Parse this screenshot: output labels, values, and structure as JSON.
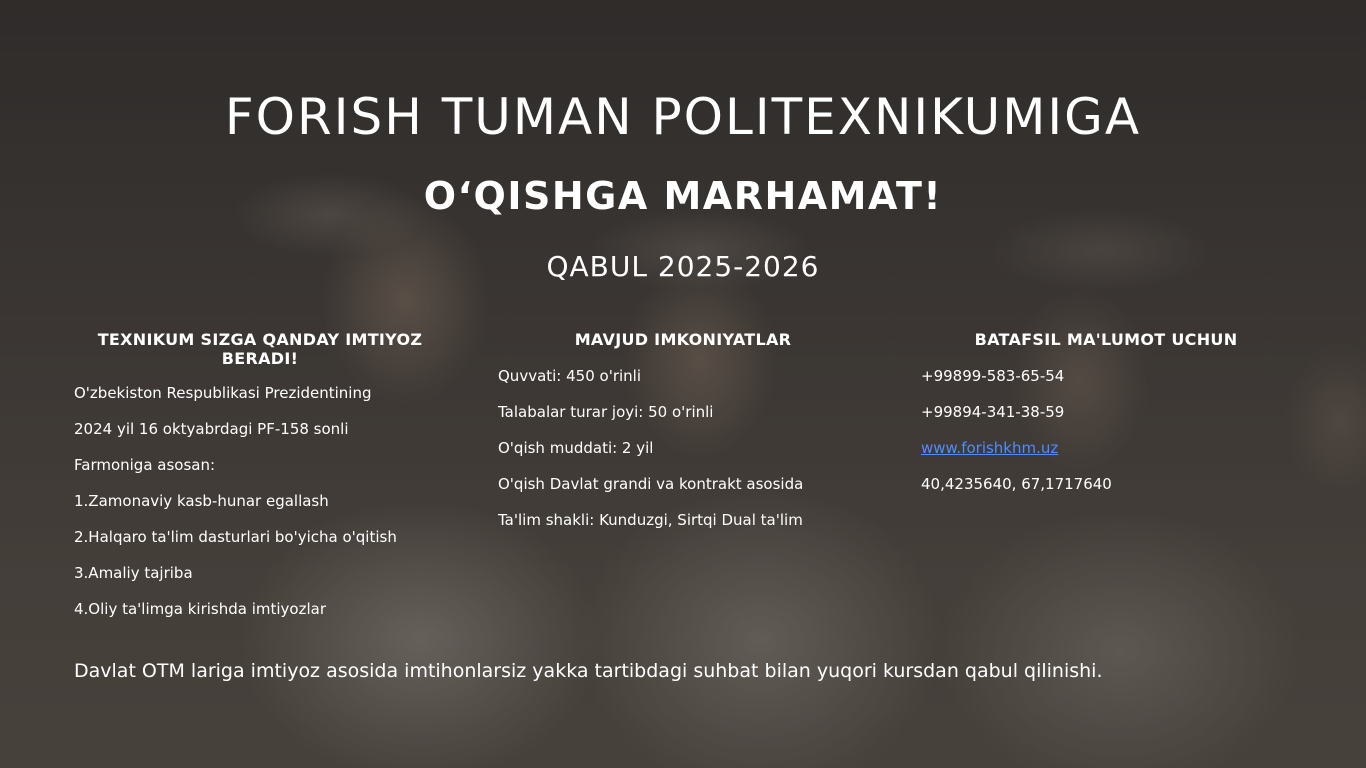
{
  "header": {
    "title": "FORISH TUMAN POLITEXNIKUMIGA",
    "subtitle": "O‘QISHGA MARHAMAT!",
    "admission": "QABUL 2025-2026"
  },
  "columns": {
    "benefits": {
      "heading": "TEXNIKUM SIZGA QANDAY IMTIYOZ BERADI!",
      "items": [
        "O'zbekiston Respublikasi Prezidentining",
        "2024 yil 16 oktyabrdagi PF-158 sonli",
        "Farmoniga asosan:",
        "1.Zamonaviy kasb-hunar egallash",
        "2.Halqaro ta'lim dasturlari bo'yicha o'qitish",
        "3.Amaliy tajriba",
        "4.Oliy ta'limga kirishda imtiyozlar"
      ]
    },
    "facilities": {
      "heading": "MAVJUD IMKONIYATLAR",
      "items": [
        "Quvvati: 450 o'rinli",
        "Talabalar turar joyi: 50 o'rinli",
        "O'qish muddati: 2 yil",
        "O'qish Davlat grandi va kontrakt asosida",
        "Ta'lim shakli: Kunduzgi, Sirtqi Dual ta'lim"
      ]
    },
    "contact": {
      "heading": "BATAFSIL MA'LUMOT UCHUN",
      "phone1": "+99899-583-65-54",
      "phone2": "+99894-341-38-59",
      "website": "www.forishkhm.uz",
      "coordinates": "40,4235640, 67,1717640"
    }
  },
  "footer": {
    "text": "Davlat OTM lariga imtiyoz asosida imtihonlarsiz yakka tartibdagi suhbat bilan yuqori kursdan qabul qilinishi."
  },
  "colors": {
    "text": "#ffffff",
    "link": "#4f8cff"
  }
}
